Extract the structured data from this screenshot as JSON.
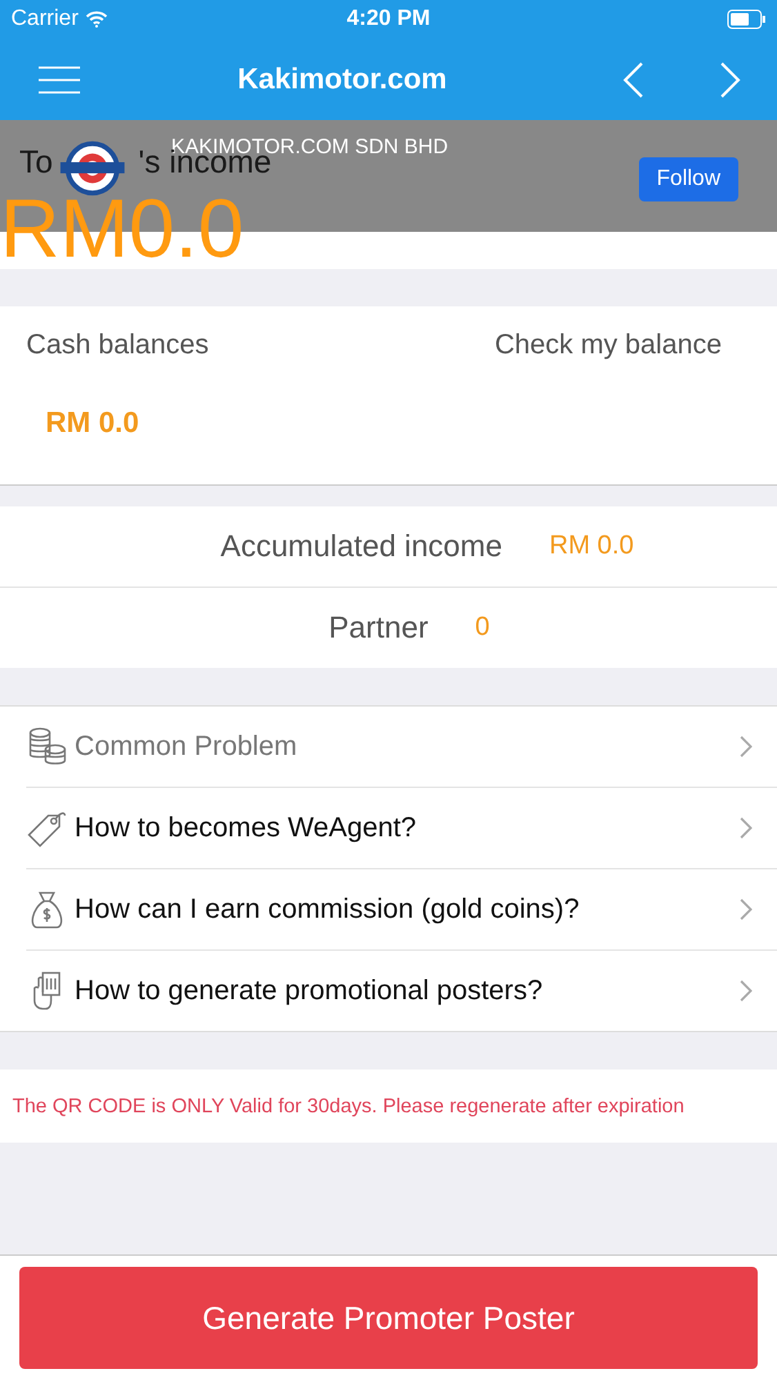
{
  "status_bar": {
    "carrier": "Carrier",
    "time": "4:20 PM"
  },
  "nav": {
    "title": "Kakimotor.com"
  },
  "banner": {
    "name": "KAKIMOTOR.COM SDN BHD",
    "button": "Follow"
  },
  "income": {
    "label_start": "To",
    "label_end": "'s income",
    "value": "RM0.0"
  },
  "cash": {
    "label": "Cash balances",
    "link": "Check my balance",
    "value": "RM 0.0"
  },
  "stats": [
    {
      "label": "Accumulated income",
      "value": "RM 0.0"
    },
    {
      "label": "Partner",
      "value": "0"
    }
  ],
  "menu": [
    {
      "kind": "coins",
      "label": "Common Problem",
      "muted": true
    },
    {
      "kind": "tag",
      "label": "How to becomes WeAgent?",
      "muted": false
    },
    {
      "kind": "moneybag",
      "label": "How can I earn commission (gold coins)?",
      "muted": false
    },
    {
      "kind": "hand",
      "label": "How to generate promotional posters?",
      "muted": false
    }
  ],
  "notice": "The QR CODE is ONLY Valid for 30days. Please regenerate after expiration",
  "action_button": "Generate Promoter Poster"
}
